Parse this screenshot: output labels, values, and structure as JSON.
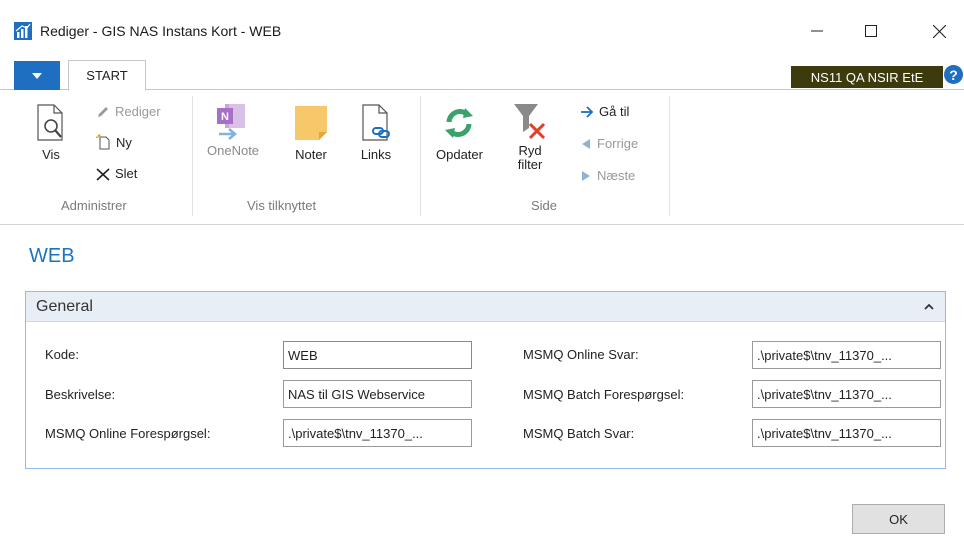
{
  "window": {
    "title": "Rediger - GIS NAS Instans Kort - WEB",
    "minimize_icon": "minimize-icon",
    "maximize_icon": "maximize-icon",
    "close_icon": "close-icon"
  },
  "ribbon_tabs": {
    "file_icon": "dropdown-arrow-icon",
    "start_label": "START",
    "environment_badge": "NS11 QA NSIR EtE",
    "help_label": "?"
  },
  "ribbon": {
    "groups": [
      {
        "label": "Administrer"
      },
      {
        "label": "Vis tilknyttet"
      },
      {
        "label": "Side"
      }
    ],
    "vis_label": "Vis",
    "rediger_label": "Rediger",
    "ny_label": "Ny",
    "slet_label": "Slet",
    "onenote_label": "OneNote",
    "noter_label": "Noter",
    "links_label": "Links",
    "opdater_label": "Opdater",
    "ryd_filter_label_1": "Ryd",
    "ryd_filter_label_2": "filter",
    "ga_til_label": "Gå til",
    "forrige_label": "Forrige",
    "naeste_label": "Næste"
  },
  "page": {
    "title": "WEB"
  },
  "general": {
    "header": "General",
    "fields": {
      "kode_label": "Kode:",
      "kode_value": "WEB",
      "beskrivelse_label": "Beskrivelse:",
      "beskrivelse_value": "NAS til GIS Webservice",
      "msmq_online_foresp_label": "MSMQ Online Forespørgsel:",
      "msmq_online_foresp_value": ".\\private$\\tnv_11370_...",
      "msmq_online_svar_label": "MSMQ Online Svar:",
      "msmq_online_svar_value": ".\\private$\\tnv_11370_...",
      "msmq_batch_foresp_label": "MSMQ Batch Forespørgsel:",
      "msmq_batch_foresp_value": ".\\private$\\tnv_11370_...",
      "msmq_batch_svar_label": "MSMQ Batch Svar:",
      "msmq_batch_svar_value": ".\\private$\\tnv_11370_..."
    }
  },
  "footer": {
    "ok_label": "OK"
  },
  "colors": {
    "accent": "#1e73be",
    "environment_badge_bg": "#3d3b0e",
    "fasttab_border": "#8fbbe6"
  }
}
